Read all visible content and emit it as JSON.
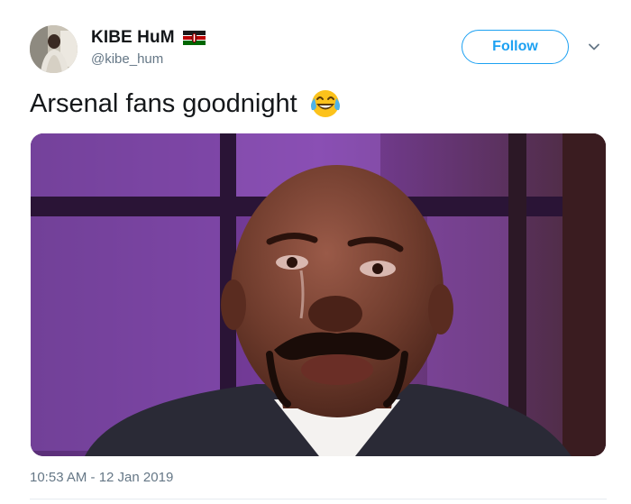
{
  "tweet": {
    "display_name": "KIBE HuM",
    "handle": "@kibe_hum",
    "name_badge": "kenya-flag-icon",
    "follow_label": "Follow",
    "menu_icon": "chevron-down-icon",
    "text": "Arsenal fans goodnight",
    "emoji": "face-with-tears-of-joy-icon",
    "timestamp": "10:53 AM - 12 Jan 2019"
  },
  "colors": {
    "accent": "#1da1f2",
    "text": "#14171a",
    "secondary_text": "#657786",
    "divider": "#e6ecf0"
  }
}
